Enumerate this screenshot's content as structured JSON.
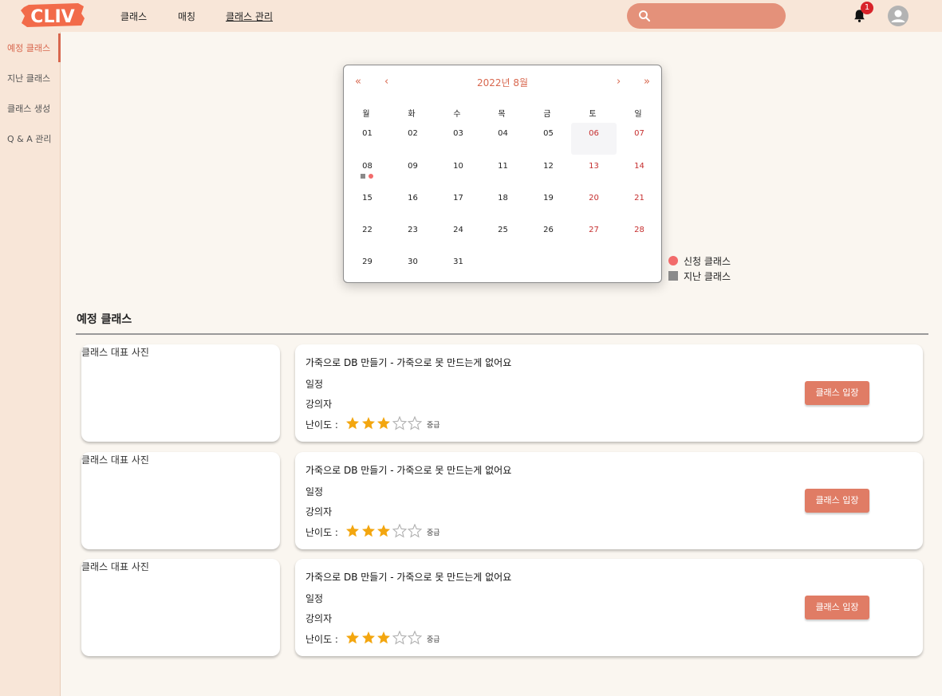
{
  "header": {
    "logo_text": "CLIV",
    "nav": [
      "클래스",
      "매칭",
      "클래스 관리"
    ],
    "active_nav": "클래스 관리",
    "search_placeholder": "",
    "notification_count": "1"
  },
  "sidebar": {
    "items": [
      "예정 클래스",
      "지난 클래스",
      "클래스 생성",
      "Q & A 관리"
    ],
    "active": "예정 클래스"
  },
  "calendar": {
    "nav_first": "«",
    "nav_prev": "‹",
    "nav_next": "›",
    "nav_last": "»",
    "title": "2022년 8월",
    "weekdays": [
      "월",
      "화",
      "수",
      "목",
      "금",
      "토",
      "일"
    ],
    "days": [
      [
        "01",
        "02",
        "03",
        "04",
        "05",
        "06",
        "07"
      ],
      [
        "08",
        "09",
        "10",
        "11",
        "12",
        "13",
        "14"
      ],
      [
        "15",
        "16",
        "17",
        "18",
        "19",
        "20",
        "21"
      ],
      [
        "22",
        "23",
        "24",
        "25",
        "26",
        "27",
        "28"
      ],
      [
        "29",
        "30",
        "31",
        "",
        "",
        "",
        ""
      ]
    ],
    "highlighted_day": "06",
    "marked_day": "08"
  },
  "legend": [
    {
      "label": "신청 클래스",
      "color": "#f26b6b",
      "shape": "circle"
    },
    {
      "label": "지난 클래스",
      "color": "#8a8a8a",
      "shape": "square"
    }
  ],
  "section": {
    "title": "예정 클래스"
  },
  "classes": [
    {
      "photo_label": "클래스 대표 사진",
      "title": "가죽으로 DB 만들기 - 가죽으로 못 만드는게 없어요",
      "schedule": "일정",
      "lecturer": "강의자",
      "level_label": "난이도 :",
      "rating": 3,
      "max_rating": 5,
      "level_text": "중급",
      "button": "클래스 입장"
    },
    {
      "photo_label": "클래스 대표 사진",
      "title": "가죽으로 DB 만들기 - 가죽으로 못 만드는게 없어요",
      "schedule": "일정",
      "lecturer": "강의자",
      "level_label": "난이도 :",
      "rating": 3,
      "max_rating": 5,
      "level_text": "중급",
      "button": "클래스 입장"
    },
    {
      "photo_label": "클래스 대표 사진",
      "title": "가죽으로 DB 만들기 - 가죽으로 못 만드는게 없어요",
      "schedule": "일정",
      "lecturer": "강의자",
      "level_label": "난이도 :",
      "rating": 3,
      "max_rating": 5,
      "level_text": "중급",
      "button": "클래스 입장"
    }
  ],
  "colors": {
    "accent": "#e07c65",
    "header_bg": "#f8e6d8",
    "star_filled": "#f3a60f",
    "star_empty": "#b0b0b0"
  }
}
